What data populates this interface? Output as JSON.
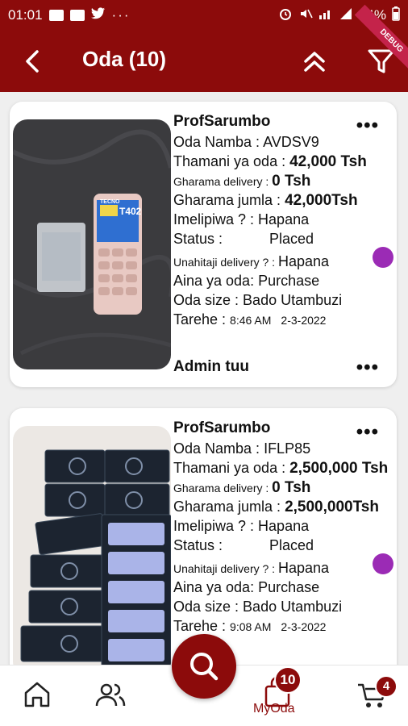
{
  "status_bar": {
    "time": "01:01",
    "dots": "···",
    "battery": "64%"
  },
  "header": {
    "title": "Oda (10)",
    "ribbon": "DEBUG"
  },
  "labels": {
    "order_number": "Oda Namba : ",
    "order_value": "Thamani ya oda : ",
    "delivery_cost": "Gharama delivery : ",
    "total_cost": "Gharama jumla : ",
    "paid": "Imelipiwa ? : ",
    "status": "Status :",
    "needs_delivery": "Unahitaji delivery ? : ",
    "order_type": "Aina ya oda: ",
    "order_size": "Oda size : ",
    "date": "Tarehe : "
  },
  "orders": [
    {
      "seller": "ProfSarumbo",
      "order_number": "AVDSV9",
      "order_value": "42,000 Tsh",
      "delivery_cost": "0 Tsh",
      "total_cost": "42,000Tsh",
      "paid": "Hapana",
      "status": "Placed",
      "needs_delivery": "Hapana",
      "order_type": "Purchase",
      "order_size": "Bado Utambuzi",
      "time": "8:46 AM",
      "date": "2-3-2022",
      "footer": "Admin tuu",
      "more": "•••",
      "status_color": "#9b2bb5"
    },
    {
      "seller": "ProfSarumbo",
      "order_number": "IFLP85",
      "order_value": "2,500,000 Tsh",
      "delivery_cost": "0 Tsh",
      "total_cost": "2,500,000Tsh",
      "paid": "Hapana",
      "status": "Placed",
      "needs_delivery": "Hapana",
      "order_type": "Purchase",
      "order_size": "Bado Utambuzi",
      "time": "9:08 AM",
      "date": "2-3-2022",
      "more": "•••",
      "status_color": "#9b2bb5"
    }
  ],
  "phone_label": {
    "brand": "TECNO",
    "model": "T402"
  },
  "bottom_nav": {
    "myoda_label": "MyOda",
    "myoda_badge": "10",
    "cart_badge": "4"
  },
  "colors": {
    "primary": "#8c0b0b",
    "status_dot": "#9b2bb5"
  }
}
